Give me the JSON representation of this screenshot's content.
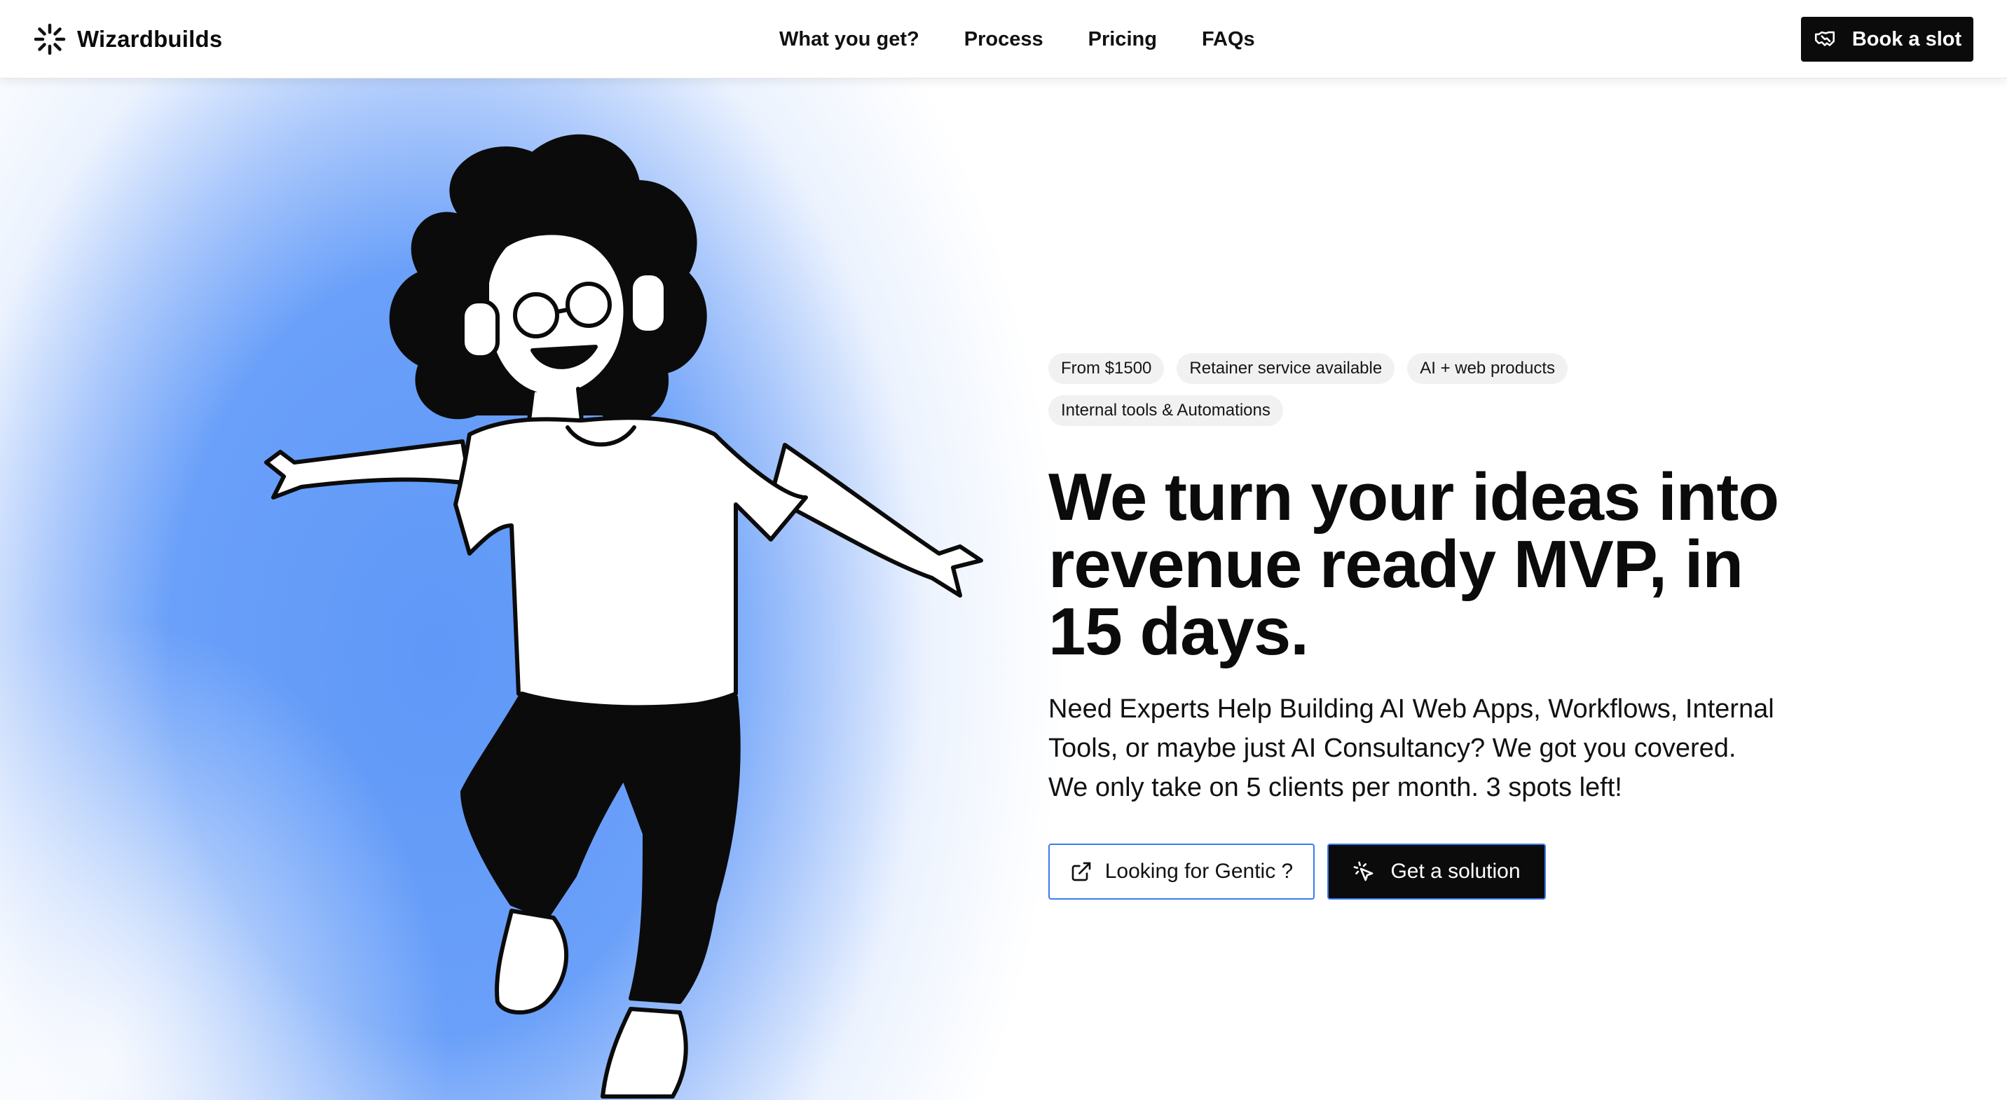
{
  "header": {
    "brand_name": "Wizardbuilds",
    "logo_icon": "sparkle-burst-icon",
    "nav": [
      {
        "label": "What you get?"
      },
      {
        "label": "Process"
      },
      {
        "label": "Pricing"
      },
      {
        "label": "FAQs"
      }
    ],
    "book_button": {
      "label": "Book a slot",
      "icon": "handshake-icon"
    }
  },
  "hero": {
    "tags": [
      "From $1500",
      "Retainer service available",
      "AI + web products",
      "Internal tools & Automations"
    ],
    "headline": "We turn your ideas into revenue ready MVP, in 15 days.",
    "subtext_lines": [
      "Need Experts Help Building AI Web Apps, Workflows, Internal",
      "Tools, or maybe just AI Consultancy? We got you covered.",
      "We only take on 5 clients per month. 3 spots left!"
    ],
    "cta_secondary": {
      "label": "Looking for Gentic ?",
      "icon": "external-link-icon"
    },
    "cta_primary": {
      "label": "Get a solution",
      "icon": "cursor-click-icon"
    }
  },
  "colors": {
    "accent_blue": "#6aa0f9",
    "button_dark": "#0b0b0b",
    "button_border": "#3b7bf0",
    "tag_bg": "#f1f1f1"
  }
}
